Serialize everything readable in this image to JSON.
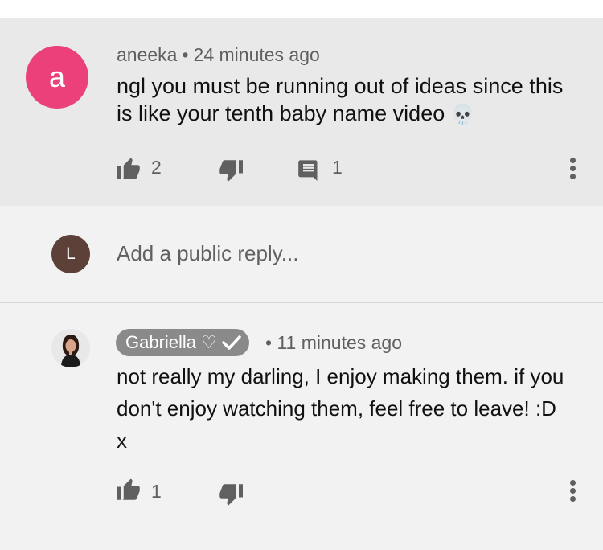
{
  "comment": {
    "avatar_letter": "a",
    "avatar_color": "#ec407a",
    "author": "aneeka",
    "separator": "•",
    "timestamp": "24 minutes ago",
    "text": "ngl you must be running out of ideas since this is like your tenth baby name video",
    "emoji": "💀",
    "like_count": "2",
    "reply_count": "1"
  },
  "reply_box": {
    "avatar_letter": "L",
    "avatar_color": "#5d4037",
    "placeholder": "Add a public reply..."
  },
  "reply": {
    "author": "Gabriella",
    "heart": "♡",
    "separator": "•",
    "timestamp": "11 minutes ago",
    "text": "not really my darling, I enjoy making them. if you don't enjoy watching them, feel free to leave! :D x",
    "like_count": "1"
  },
  "colors": {
    "comment_background": "#e9e9e9",
    "page_background": "#f2f2f2",
    "secondary_text": "#606060",
    "badge_background": "#8a8a8a"
  },
  "icons": [
    "thumb-up-icon",
    "thumb-down-icon",
    "comment-icon",
    "more-vertical-icon",
    "verified-check-icon"
  ]
}
